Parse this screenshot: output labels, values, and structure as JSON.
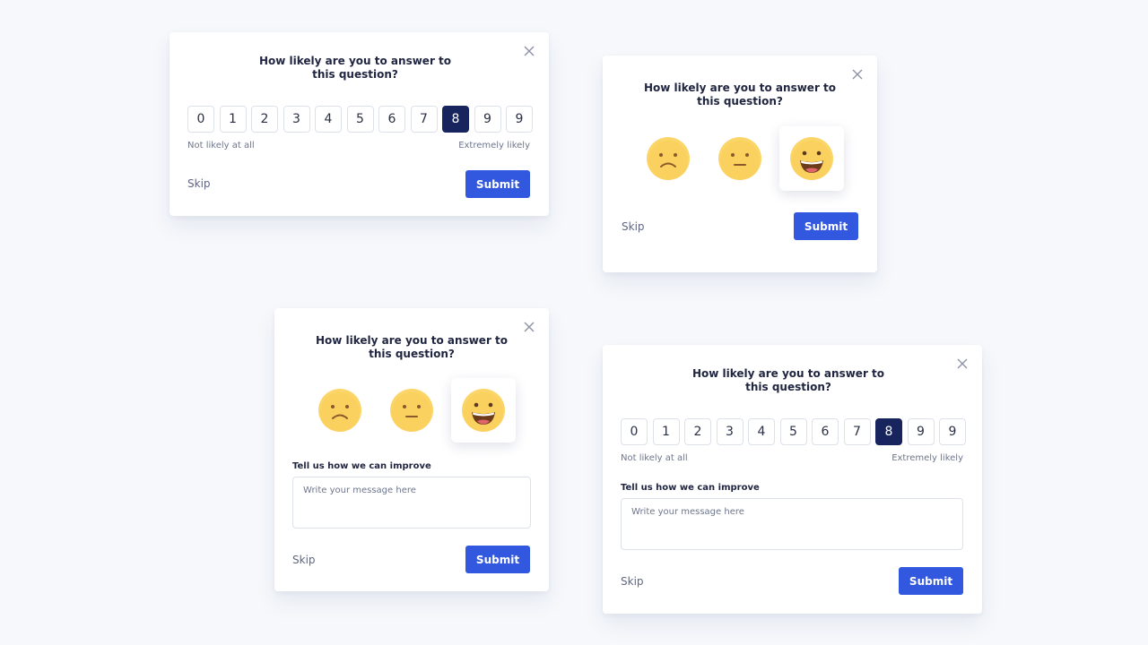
{
  "question": "How likely are you to answer to this question?",
  "scale": {
    "values": [
      "0",
      "1",
      "2",
      "3",
      "4",
      "5",
      "6",
      "7",
      "8",
      "9",
      "9"
    ],
    "selected_index": 8,
    "low_label": "Not likely at all",
    "high_label": "Extremely likely"
  },
  "emojis": [
    {
      "icon": "sad-face-icon"
    },
    {
      "icon": "neutral-face-icon"
    },
    {
      "icon": "happy-face-icon",
      "selected": true
    }
  ],
  "feedback": {
    "label": "Tell us how we can improve",
    "placeholder": "Write your message here"
  },
  "actions": {
    "skip": "Skip",
    "submit": "Submit"
  },
  "colors": {
    "primary": "#3358e0",
    "selected": "#17245e",
    "emoji": "#fbd568"
  }
}
